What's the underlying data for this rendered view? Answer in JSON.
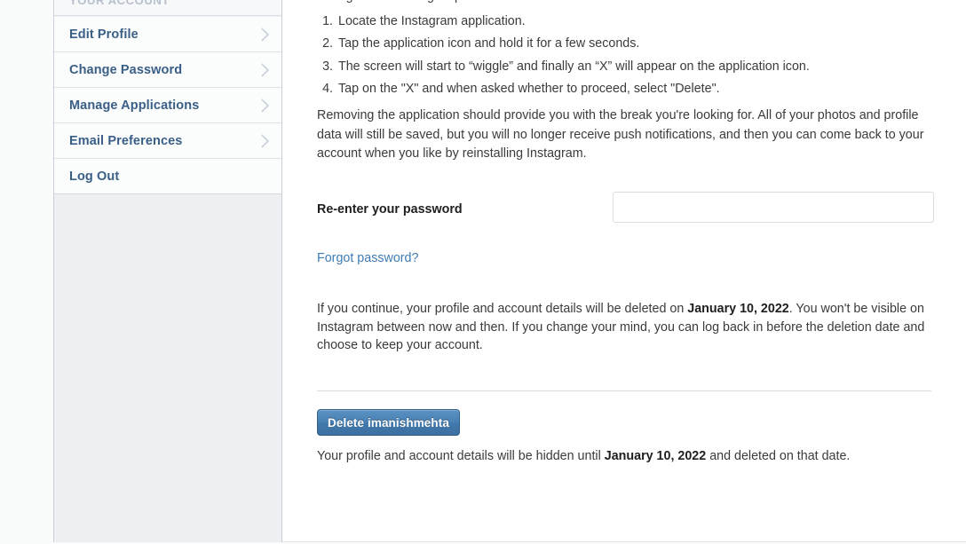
{
  "sidebar": {
    "header": "YOUR ACCOUNT",
    "items": [
      {
        "label": "Edit Profile",
        "chevron": true
      },
      {
        "label": "Change Password",
        "chevron": true
      },
      {
        "label": "Manage Applications",
        "chevron": true
      },
      {
        "label": "Email Preferences",
        "chevron": true
      },
      {
        "label": "Log Out",
        "chevron": false
      }
    ]
  },
  "main": {
    "intro_clipped": "through the following steps:",
    "steps": [
      "Locate the Instagram application.",
      "Tap the application icon and hold it for a few seconds.",
      "The screen will start to “wiggle” and finally an “X” will appear on the application icon.",
      "Tap on the \"X\" and when asked whether to proceed, select \"Delete\"."
    ],
    "removing_paragraph": "Removing the application should provide you with the break you're looking for. All of your photos and profile data will still be saved, but you will no longer receive push notifications, and then you can come back to your account when you like by reinstalling Instagram.",
    "password_label": "Re-enter your password",
    "password_value": "",
    "password_placeholder": "",
    "forgot_link": "Forgot password?",
    "continue_text_1": "If you continue, your profile and account details will be deleted on ",
    "continue_date": "January 10, 2022",
    "continue_text_2": ". You won't be visible on Instagram between now and then. If you change your mind, you can log back in before the deletion date and choose to keep your account.",
    "delete_button": "Delete imanishmehta",
    "hidden_text_1": "Your profile and account details will be hidden until ",
    "hidden_date": "January 10, 2022",
    "hidden_text_2": " and deleted on that date."
  },
  "colors": {
    "sidebar_link": "#3a5f87",
    "link": "#3f7cb5",
    "button": "#4a81b4",
    "button_border": "#2f5f8d",
    "sidebar_bg": "#edf0f2"
  }
}
